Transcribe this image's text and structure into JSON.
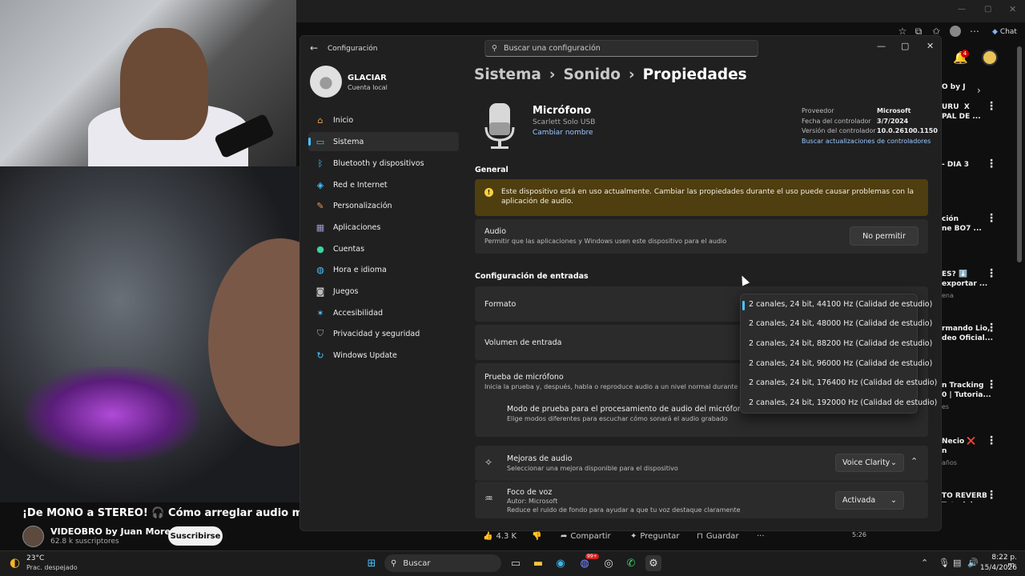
{
  "video": {
    "title": "¡De MONO a STEREO! 🎧 Cómo arreglar audio mono y con",
    "channel": "VIDEOBRO by Juan Moreno",
    "subscribers": "62.8 k suscriptores",
    "subscribe_label": "Suscribirse",
    "likes": "4.3 K",
    "share_label": "Compartir",
    "ask_label": "Preguntar",
    "save_label": "Guardar",
    "more": "···",
    "duration_badge": "5:26"
  },
  "browser": {
    "chat_label": "Chat",
    "notif_count": "4"
  },
  "recs": [
    {
      "text": "O by J",
      "sub": ""
    },
    {
      "text": "URU  X\nPAL DE ...",
      "sub": ""
    },
    {
      "text": "- DIA 3",
      "sub": ""
    },
    {
      "text": "ción\nne BO7 ...",
      "sub": ""
    },
    {
      "text": "ES? ⬇️\nexportar ...",
      "sub": "ena"
    },
    {
      "text": "rmando Lio,\ndeo Oficial...",
      "sub": ""
    },
    {
      "text": "n Tracking\n0 | Tutoria...",
      "sub": "es"
    },
    {
      "text": "Necio ❌\nn",
      "sub": "años"
    },
    {
      "text": "TO REVERB\nTutorial",
      "sub": "es"
    }
  ],
  "settings": {
    "window_title": "Configuración",
    "search_placeholder": "Buscar una configuración",
    "user": {
      "name": "GLACIAR",
      "type": "Cuenta local"
    },
    "nav": [
      {
        "label": "Inicio",
        "icon": "home-icon"
      },
      {
        "label": "Sistema",
        "icon": "system-icon"
      },
      {
        "label": "Bluetooth y dispositivos",
        "icon": "bluetooth-icon"
      },
      {
        "label": "Red e Internet",
        "icon": "wifi-icon"
      },
      {
        "label": "Personalización",
        "icon": "brush-icon"
      },
      {
        "label": "Aplicaciones",
        "icon": "apps-icon"
      },
      {
        "label": "Cuentas",
        "icon": "account-icon"
      },
      {
        "label": "Hora e idioma",
        "icon": "globe-icon"
      },
      {
        "label": "Juegos",
        "icon": "gamepad-icon"
      },
      {
        "label": "Accesibilidad",
        "icon": "accessibility-icon"
      },
      {
        "label": "Privacidad y seguridad",
        "icon": "shield-icon"
      },
      {
        "label": "Windows Update",
        "icon": "update-icon"
      }
    ],
    "breadcrumb": [
      "Sistema",
      "Sonido",
      "Propiedades"
    ],
    "device": {
      "name": "Micrófono",
      "model": "Scarlett Solo USB",
      "rename_label": "Cambiar nombre"
    },
    "driver": {
      "provider_label": "Proveedor",
      "provider": "Microsoft",
      "date_label": "Fecha del controlador",
      "date": "3/7/2024",
      "version_label": "Versión del controlador",
      "version": "10.0.26100.1150",
      "update_link": "Buscar actualizaciones de controladores"
    },
    "general_title": "General",
    "warning": "Este dispositivo está en uso actualmente. Cambiar las propiedades durante el uso puede causar problemas con la aplicación de audio.",
    "audio": {
      "title": "Audio",
      "desc": "Permitir que las aplicaciones y Windows usen este dispositivo para el audio",
      "button": "No permitir"
    },
    "input_title": "Configuración de entradas",
    "format_label": "Formato",
    "format_options": [
      "2 canales, 24 bit, 44100 Hz (Calidad de estudio)",
      "2 canales, 24 bit, 48000 Hz (Calidad de estudio)",
      "2 canales, 24 bit, 88200 Hz (Calidad de estudio)",
      "2 canales, 24 bit, 96000 Hz (Calidad de estudio)",
      "2 canales, 24 bit, 176400 Hz (Calidad de estudio)",
      "2 canales, 24 bit, 192000 Hz (Calidad de estudio)"
    ],
    "volume_label": "Volumen de entrada",
    "test": {
      "title": "Prueba de micrófono",
      "desc": "Inicia la prueba y, después, habla o reproduce audio a un nivel normal durante unos segu"
    },
    "test_mode": {
      "title": "Modo de prueba para el procesamiento de audio del micrófono",
      "desc": "Elige modos diferentes para escuchar cómo sonará el audio grabado"
    },
    "enhance": {
      "title": "Mejoras de audio",
      "desc": "Seleccionar una mejora disponible para el dispositivo",
      "value": "Voice Clarity"
    },
    "voice_focus": {
      "title": "Foco de voz",
      "author": "Autor: Microsoft",
      "desc": "Reduce el ruido de fondo para ayudar a que tu voz destaque claramente",
      "value": "Activada"
    }
  },
  "taskbar": {
    "temp": "23°C",
    "condition": "Prac. despejado",
    "search_label": "Buscar",
    "time": "8:22 p. m.",
    "date": "15/4/2026",
    "badge": "99+"
  }
}
